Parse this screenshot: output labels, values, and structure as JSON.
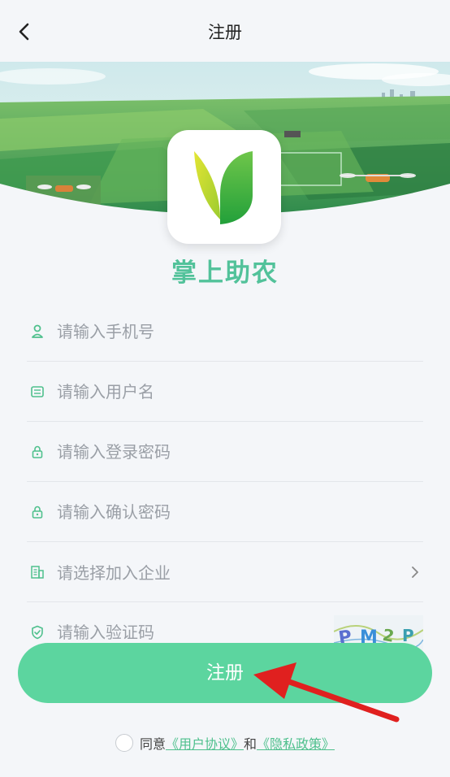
{
  "header": {
    "title": "注册"
  },
  "app": {
    "name": "掌上助农"
  },
  "form": {
    "phone_placeholder": "请输入手机号",
    "username_placeholder": "请输入用户名",
    "password_placeholder": "请输入登录密码",
    "confirm_placeholder": "请输入确认密码",
    "company_select_label": "请选择加入企业",
    "captcha_placeholder": "请输入验证码",
    "captcha_text": "PM2P"
  },
  "submit": {
    "label": "注册"
  },
  "agreement": {
    "prefix": "同意",
    "user_agreement": "《用户协议》",
    "and": "和",
    "privacy_policy": "《隐私政策》"
  },
  "colors": {
    "accent": "#5cd59f",
    "brand_text": "#52c29a",
    "arrow": "#e0201f"
  },
  "icons": {
    "back": "chevron-left-icon",
    "phone": "user-icon",
    "username": "id-card-icon",
    "password": "lock-icon",
    "confirm": "lock-icon",
    "company": "building-icon",
    "captcha": "shield-check-icon",
    "select": "chevron-right-icon"
  }
}
